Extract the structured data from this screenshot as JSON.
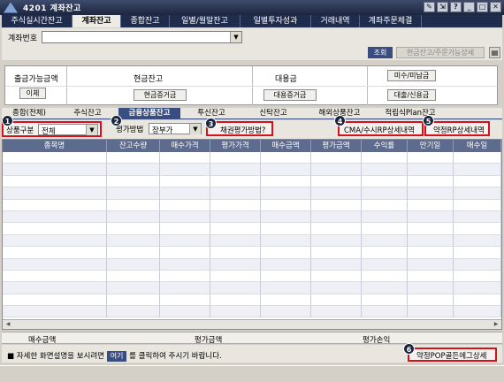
{
  "window": {
    "title": "4201 계좌잔고"
  },
  "tabs": [
    "주식실시간잔고",
    "계좌잔고",
    "종합잔고",
    "일별/월말잔고",
    "일별투자성과",
    "거래내역",
    "계좌주문체결"
  ],
  "account": {
    "label": "계좌번호",
    "value": ""
  },
  "toolbar": {
    "query": "조회",
    "cash_detail": "현금잔고/주문가능상세"
  },
  "summary": {
    "withdrawable": "출금가능금액",
    "transfer": "이체",
    "cash_balance": "현금잔고",
    "cash_deposit_btn": "현금증거금",
    "loan_amount": "대용금",
    "loan_deposit_btn": "대용증거금",
    "unpaid_btn": "미수/미납금",
    "loan_credit_btn": "대출/신용금"
  },
  "subtabs": [
    "종합(전체)",
    "주식잔고",
    "금융상품잔고",
    "투신잔고",
    "신탁잔고",
    "해외상품잔고",
    "적립식Plan잔고"
  ],
  "filters": {
    "product_label": "상품구분",
    "product_value": "전체",
    "eval_label": "평가방법",
    "eval_value": "장부가",
    "bond_eval_btn": "채권평가방법?",
    "cma_btn": "CMA/수시RP상세내역",
    "rp_btn": "약정RP상세내역"
  },
  "badges": [
    "1",
    "2",
    "3",
    "4",
    "5",
    "6"
  ],
  "grid": {
    "columns": [
      "종목명",
      "잔고수량",
      "매수가격",
      "평가가격",
      "매수금액",
      "평가금액",
      "수익률",
      "만기일",
      "매수일"
    ]
  },
  "totals": {
    "buy_amount": "매수금액",
    "eval_amount": "평가금액",
    "eval_pl": "평가손익"
  },
  "footer": {
    "prefix": "■ 자세한 화면설명을 보시려면",
    "here": "여기",
    "suffix": "를 클릭하여 주시기 바랍니다.",
    "pop_btn": "약정POP골든에그상세"
  }
}
